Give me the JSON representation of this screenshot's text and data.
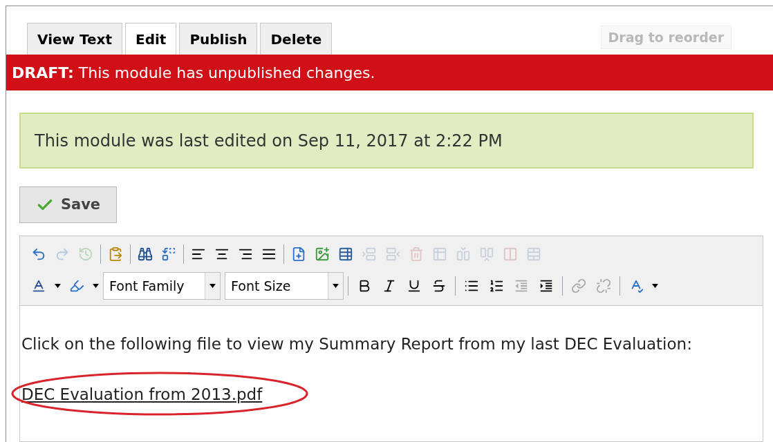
{
  "tabs": [
    {
      "label": "View Text",
      "selected": false
    },
    {
      "label": "Edit",
      "selected": true
    },
    {
      "label": "Publish",
      "selected": false
    },
    {
      "label": "Delete",
      "selected": false
    }
  ],
  "reorder": {
    "label": "Drag to reorder",
    "disabled": true
  },
  "draft_banner": {
    "text": "**DRAFT:** This module has unpublished changes."
  },
  "notice": "This module was last edited on Sep 11, 2017 at 2:22 PM",
  "save_button": "Save",
  "toolbar": {
    "row1": [
      {
        "disabled": false
      },
      {
        "disabled": true
      },
      {
        "disabled": true
      },
      {
        "disabled": false
      },
      {
        "disabled": false
      },
      {
        "disabled": false
      },
      {
        "disabled": false
      },
      {
        "disabled": false
      },
      {
        "disabled": false
      },
      {
        "disabled": false
      },
      {
        "disabled": false
      },
      {
        "disabled": false
      },
      {
        "disabled": false
      },
      {
        "disabled": true
      },
      {
        "disabled": true
      },
      {
        "disabled": true
      },
      {
        "disabled": true
      },
      {
        "disabled": true
      },
      {
        "disabled": true
      },
      {
        "disabled": true
      },
      {
        "disabled": true
      }
    ],
    "font_family": "Font Family",
    "font_size": "Font Size",
    "row2": [
      {
        "disabled": false
      },
      {
        "disabled": false
      },
      {
        "disabled": false
      },
      {
        "disabled": false
      },
      {
        "disabled": false
      },
      {
        "disabled": false
      },
      {
        "disabled": false
      },
      {
        "disabled": false
      },
      {
        "disabled": true
      },
      {
        "disabled": false
      },
      {
        "disabled": true
      },
      {
        "disabled": true
      },
      {
        "disabled": false
      }
    ]
  },
  "content": {
    "paragraph": "Click on the following file to view my Summary Report from my last DEC Evaluation:",
    "link": "DEC Evaluation from 2013.pdf",
    "link_circled": true
  }
}
